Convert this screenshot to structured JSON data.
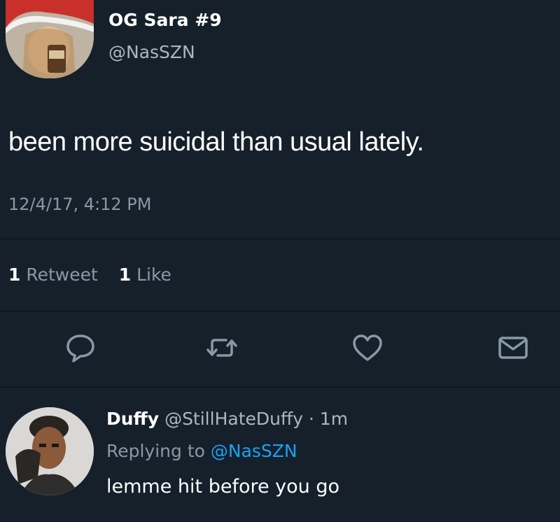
{
  "tweet": {
    "display_name": "OG Sara #9",
    "handle": "@NasSZN",
    "text": "been more suicidal than usual lately.",
    "timestamp": "12/4/17, 4:12 PM",
    "retweet_count": "1",
    "retweet_label": "Retweet",
    "like_count": "1",
    "like_label": "Like"
  },
  "actions": {
    "reply_icon": "reply-bubble-icon",
    "retweet_icon": "retweet-icon",
    "like_icon": "heart-icon",
    "dm_icon": "envelope-icon"
  },
  "reply": {
    "display_name": "Duffy",
    "handle": "@StillHateDuffy",
    "separator": " · ",
    "time_ago": "1m",
    "replying_prefix": "Replying to ",
    "replying_to": "@NasSZN",
    "text": "lemme hit before you go"
  },
  "colors": {
    "background": "#15202b",
    "secondary_text": "#8899a6",
    "link": "#1da1f2"
  }
}
